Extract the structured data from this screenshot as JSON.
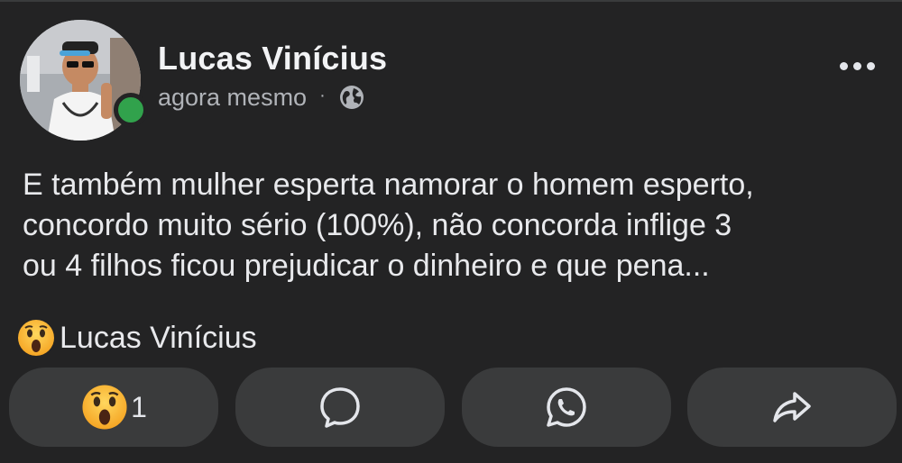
{
  "post": {
    "author": {
      "name": "Lucas Vinícius",
      "online": true
    },
    "timestamp": "agora mesmo",
    "separator": "·",
    "privacy_icon": "globe-icon",
    "more_icon": "more-options-icon",
    "text_lines": [
      "E também mulher esperta namorar o homem esperto,",
      "concordo muito sério (100%), não concorda inflige 3",
      "ou 4 filhos ficou prejudicar o dinheiro e que pena..."
    ],
    "reaction_summary": {
      "emoji": "wow-emoji",
      "names": "Lucas Vinícius"
    }
  },
  "actions": {
    "react": {
      "icon": "wow-emoji",
      "count": "1"
    },
    "comment": {
      "icon": "comment-bubble-icon"
    },
    "whatsapp": {
      "icon": "whatsapp-icon"
    },
    "share": {
      "icon": "share-arrow-icon"
    }
  },
  "colors": {
    "background": "#232324",
    "button": "#3a3b3c",
    "online": "#31a24c",
    "secondary_text": "#b0b3b8",
    "primary_text": "#e4e6eb"
  }
}
